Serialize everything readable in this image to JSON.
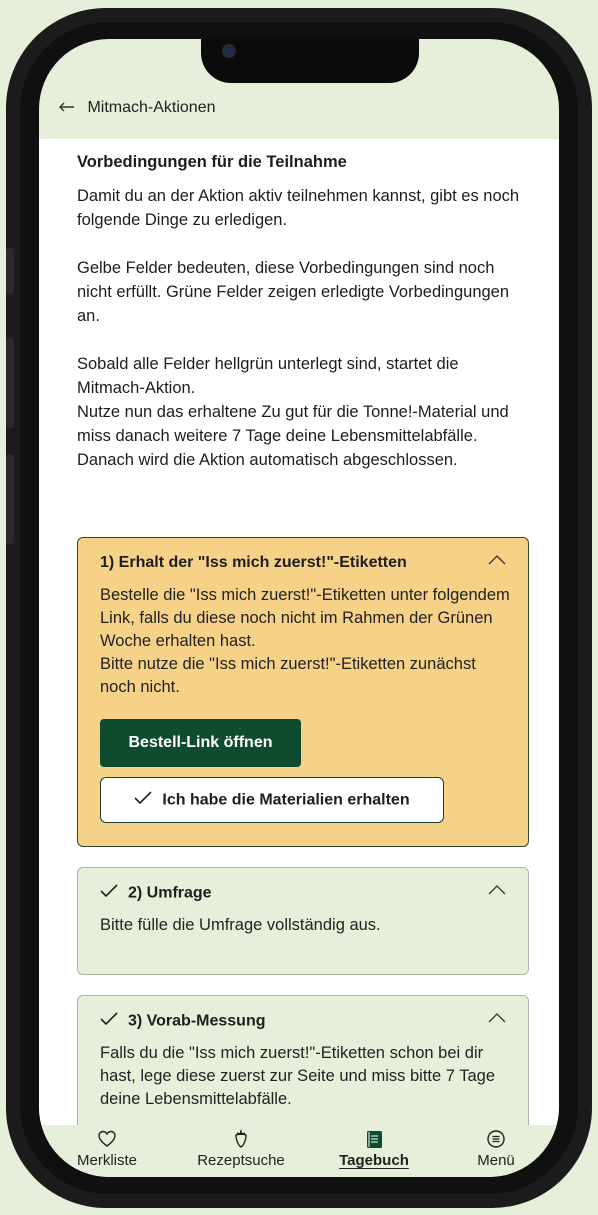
{
  "header": {
    "back_label": "Mitmach-Aktionen"
  },
  "intro": {
    "title": "Vorbedingungen für die Teilnahme",
    "text": "Damit du an der Aktion aktiv teilnehmen kannst, gibt es noch folgende Dinge zu erledigen.\n\nGelbe Felder bedeuten, diese Vorbedingungen sind noch nicht erfüllt. Grüne Felder zeigen erledigte Vorbedingungen an.\n\nSobald alle Felder hellgrün unterlegt sind, startet die Mitmach-Aktion.\nNutze nun das erhaltene Zu gut für die Tonne!-Material und miss danach weitere 7 Tage deine Lebensmittelabfälle.\nDanach wird die Aktion automatisch abgeschlossen."
  },
  "cards": [
    {
      "title": "1) Erhalt der \"Iss mich zuerst!\"-Etiketten",
      "status": "pending",
      "color": "#f6d188",
      "body": "Bestelle die \"Iss mich zuerst!\"-Etiketten unter folgendem Link, falls du diese noch nicht im Rahmen der Grünen Woche erhalten hast.\nBitte nutze die \"Iss mich zuerst!\"-Etiketten zunächst noch nicht.",
      "primary_button": "Bestell-Link öffnen",
      "secondary_button": "Ich habe die Materialien erhalten"
    },
    {
      "title": "2) Umfrage",
      "status": "done",
      "color": "#e6efd9",
      "body": "Bitte fülle die Umfrage vollständig aus."
    },
    {
      "title": "3) Vorab-Messung",
      "status": "done",
      "color": "#e6efd9",
      "body": "Falls du die \"Iss mich zuerst!\"-Etiketten schon bei dir hast, lege diese zuerst zur Seite und miss bitte 7 Tage deine Lebensmittelabfälle."
    }
  ],
  "tabbar": {
    "items": [
      {
        "label": "Merkliste",
        "icon": "heart-icon"
      },
      {
        "label": "Rezeptsuche",
        "icon": "strawberry-icon"
      },
      {
        "label": "Tagebuch",
        "icon": "notebook-icon",
        "active": true
      },
      {
        "label": "Menü",
        "icon": "menu-icon"
      }
    ]
  },
  "colors": {
    "primary": "#0f4b2e",
    "background": "#e6efd9",
    "pending": "#f6d188"
  }
}
